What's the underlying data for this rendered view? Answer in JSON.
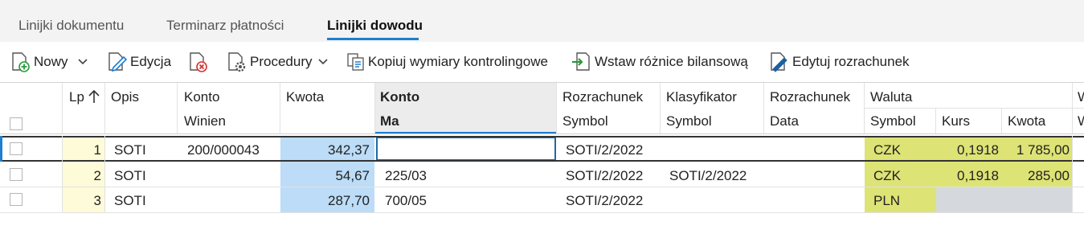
{
  "tabs": [
    {
      "label": "Linijki dokumentu"
    },
    {
      "label": "Terminarz płatności"
    },
    {
      "label": "Linijki dowodu"
    }
  ],
  "toolbar": {
    "new_label": "Nowy",
    "edit_label": "Edycja",
    "procedures_label": "Procedury",
    "copy_dims_label": "Kopiuj wymiary kontrolingowe",
    "insert_diff_label": "Wstaw różnice bilansową",
    "edit_settlement_label": "Edytuj rozrachunek"
  },
  "columns": {
    "lp": "Lp",
    "opis": "Opis",
    "konto_winien_1": "Konto",
    "konto_winien_2": "Winien",
    "kwota": "Kwota",
    "konto_ma_1": "Konto",
    "konto_ma_2": "Ma",
    "rozrachunek_symbol_1": "Rozrachunek",
    "rozrachunek_symbol_2": "Symbol",
    "klasyfikator_1": "Klasyfikator",
    "klasyfikator_2": "Symbol",
    "rozrachunek_data_1": "Rozrachunek",
    "rozrachunek_data_2": "Data",
    "waluta": "Waluta",
    "waluta_symbol": "Symbol",
    "waluta_kurs": "Kurs",
    "waluta_kwota": "Kwota",
    "next_col_1": "W",
    "next_col_2": "W"
  },
  "rows": [
    {
      "lp": "1",
      "opis": "SOTI",
      "konto_winien": "200/000043",
      "kwota": "342,37",
      "konto_ma": "",
      "rozrachunek_symbol": "SOTI/2/2022",
      "klasyfikator": "",
      "rozrachunek_data": "",
      "waluta_symbol": "CZK",
      "kurs": "0,1918",
      "waluta_kwota": "1 785,00"
    },
    {
      "lp": "2",
      "opis": "SOTI",
      "konto_winien": "",
      "kwota": "54,67",
      "konto_ma": "225/03",
      "rozrachunek_symbol": "SOTI/2/2022",
      "klasyfikator": "SOTI/2/2022",
      "rozrachunek_data": "",
      "waluta_symbol": "CZK",
      "kurs": "0,1918",
      "waluta_kwota": "285,00"
    },
    {
      "lp": "3",
      "opis": "SOTI",
      "konto_winien": "",
      "kwota": "287,70",
      "konto_ma": "700/05",
      "rozrachunek_symbol": "SOTI/2/2022",
      "klasyfikator": "",
      "rozrachunek_data": "",
      "waluta_symbol": "PLN",
      "kurs": "",
      "waluta_kwota": ""
    }
  ],
  "colors": {
    "accent": "#1e7fd0",
    "kwota_bg": "#bcdcf7",
    "waluta_bg": "#dde375",
    "lp_bg": "#fdfbd8",
    "disabled_bg": "#d5d9dd"
  }
}
